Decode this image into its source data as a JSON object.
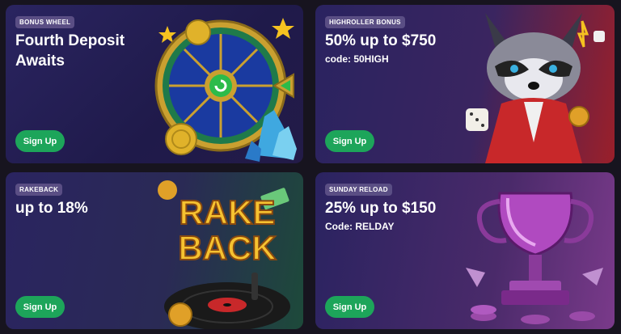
{
  "cards": [
    {
      "badge": "BONUS WHEEL",
      "title_line1": "Fourth Deposit",
      "title_line2": "Awaits",
      "button": "Sign Up",
      "art_icon": "bonus-wheel-icon"
    },
    {
      "badge": "HIGHROLLER BONUS",
      "title": "50% up to $750",
      "code": "code: 50HIGH",
      "button": "Sign Up",
      "art_icon": "raccoon-mascot-icon"
    },
    {
      "badge": "RAKEBACK",
      "title": "up to 18%",
      "button": "Sign Up",
      "art_icon": "rakeback-record-icon",
      "art_text_line1": "RAKE",
      "art_text_line2": "BACK"
    },
    {
      "badge": "SUNDAY RELOAD",
      "title": "25% up to $150",
      "code": "Code: RELDAY",
      "button": "Sign Up",
      "art_icon": "trophy-icon"
    }
  ],
  "colors": {
    "button": "#1da55a",
    "badge": "#5a4e84",
    "background": "#17141f"
  }
}
